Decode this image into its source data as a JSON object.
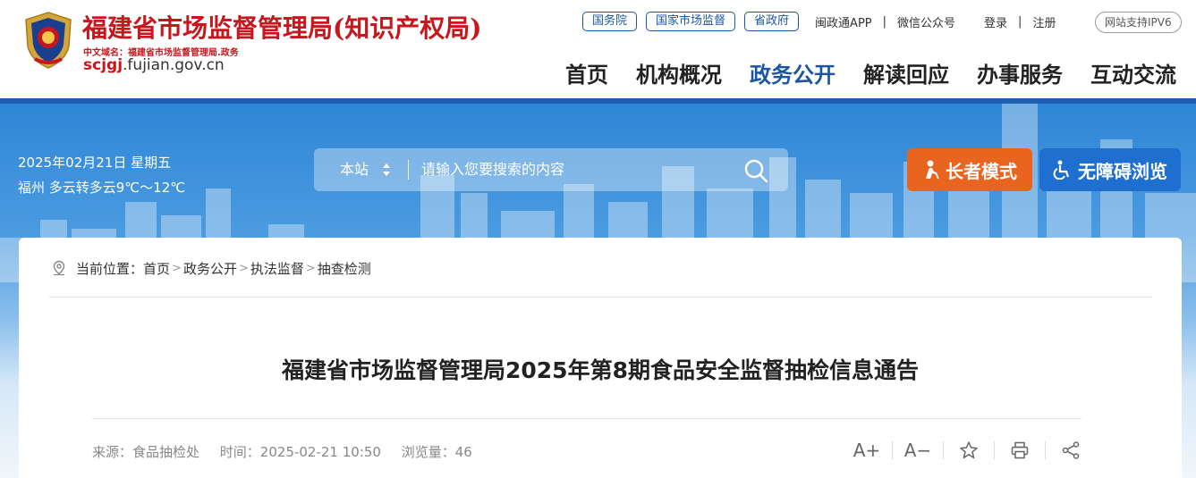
{
  "header": {
    "site_title": "福建省市场监督管理局(知识产权局)",
    "domain_cn": "中文域名：福建省市场监督管理局.政务",
    "domain_en_prefix": "scjgj",
    "domain_en_suffix": ".fujian.gov.cn",
    "top_pills": [
      "国务院",
      "国家市场监督",
      "省政府"
    ],
    "app_link": "闽政通APP",
    "wechat_link": "微信公众号",
    "login": "登录",
    "register": "注册",
    "ipv6": "网站支持IPV6",
    "nav": [
      "首页",
      "机构概况",
      "政务公开",
      "解读回应",
      "办事服务",
      "互动交流"
    ],
    "nav_active_index": 2
  },
  "banner": {
    "date": "2025年02月21日 星期五",
    "weather": "福州 多云转多云9℃～12℃",
    "search_scope": "本站",
    "search_placeholder": "请输入您要搜索的内容",
    "elder_mode": "长者模式",
    "accessible": "无障碍浏览"
  },
  "breadcrumb": {
    "prefix": "当前位置：",
    "items": [
      "首页",
      "政务公开",
      "执法监督",
      "抽查检测"
    ]
  },
  "article": {
    "title": "福建省市场监督管理局2025年第8期食品安全监督抽检信息通告",
    "source": "来源：食品抽检处",
    "time": "时间：2025-02-21 10:50",
    "views": "浏览量：46"
  },
  "tools": {
    "font_up": "A+",
    "font_down": "A−"
  },
  "colors": {
    "brand_red": "#c8161d",
    "brand_blue": "#1b56a3",
    "elder_orange": "#e8641f",
    "access_blue": "#1f6fd0"
  }
}
